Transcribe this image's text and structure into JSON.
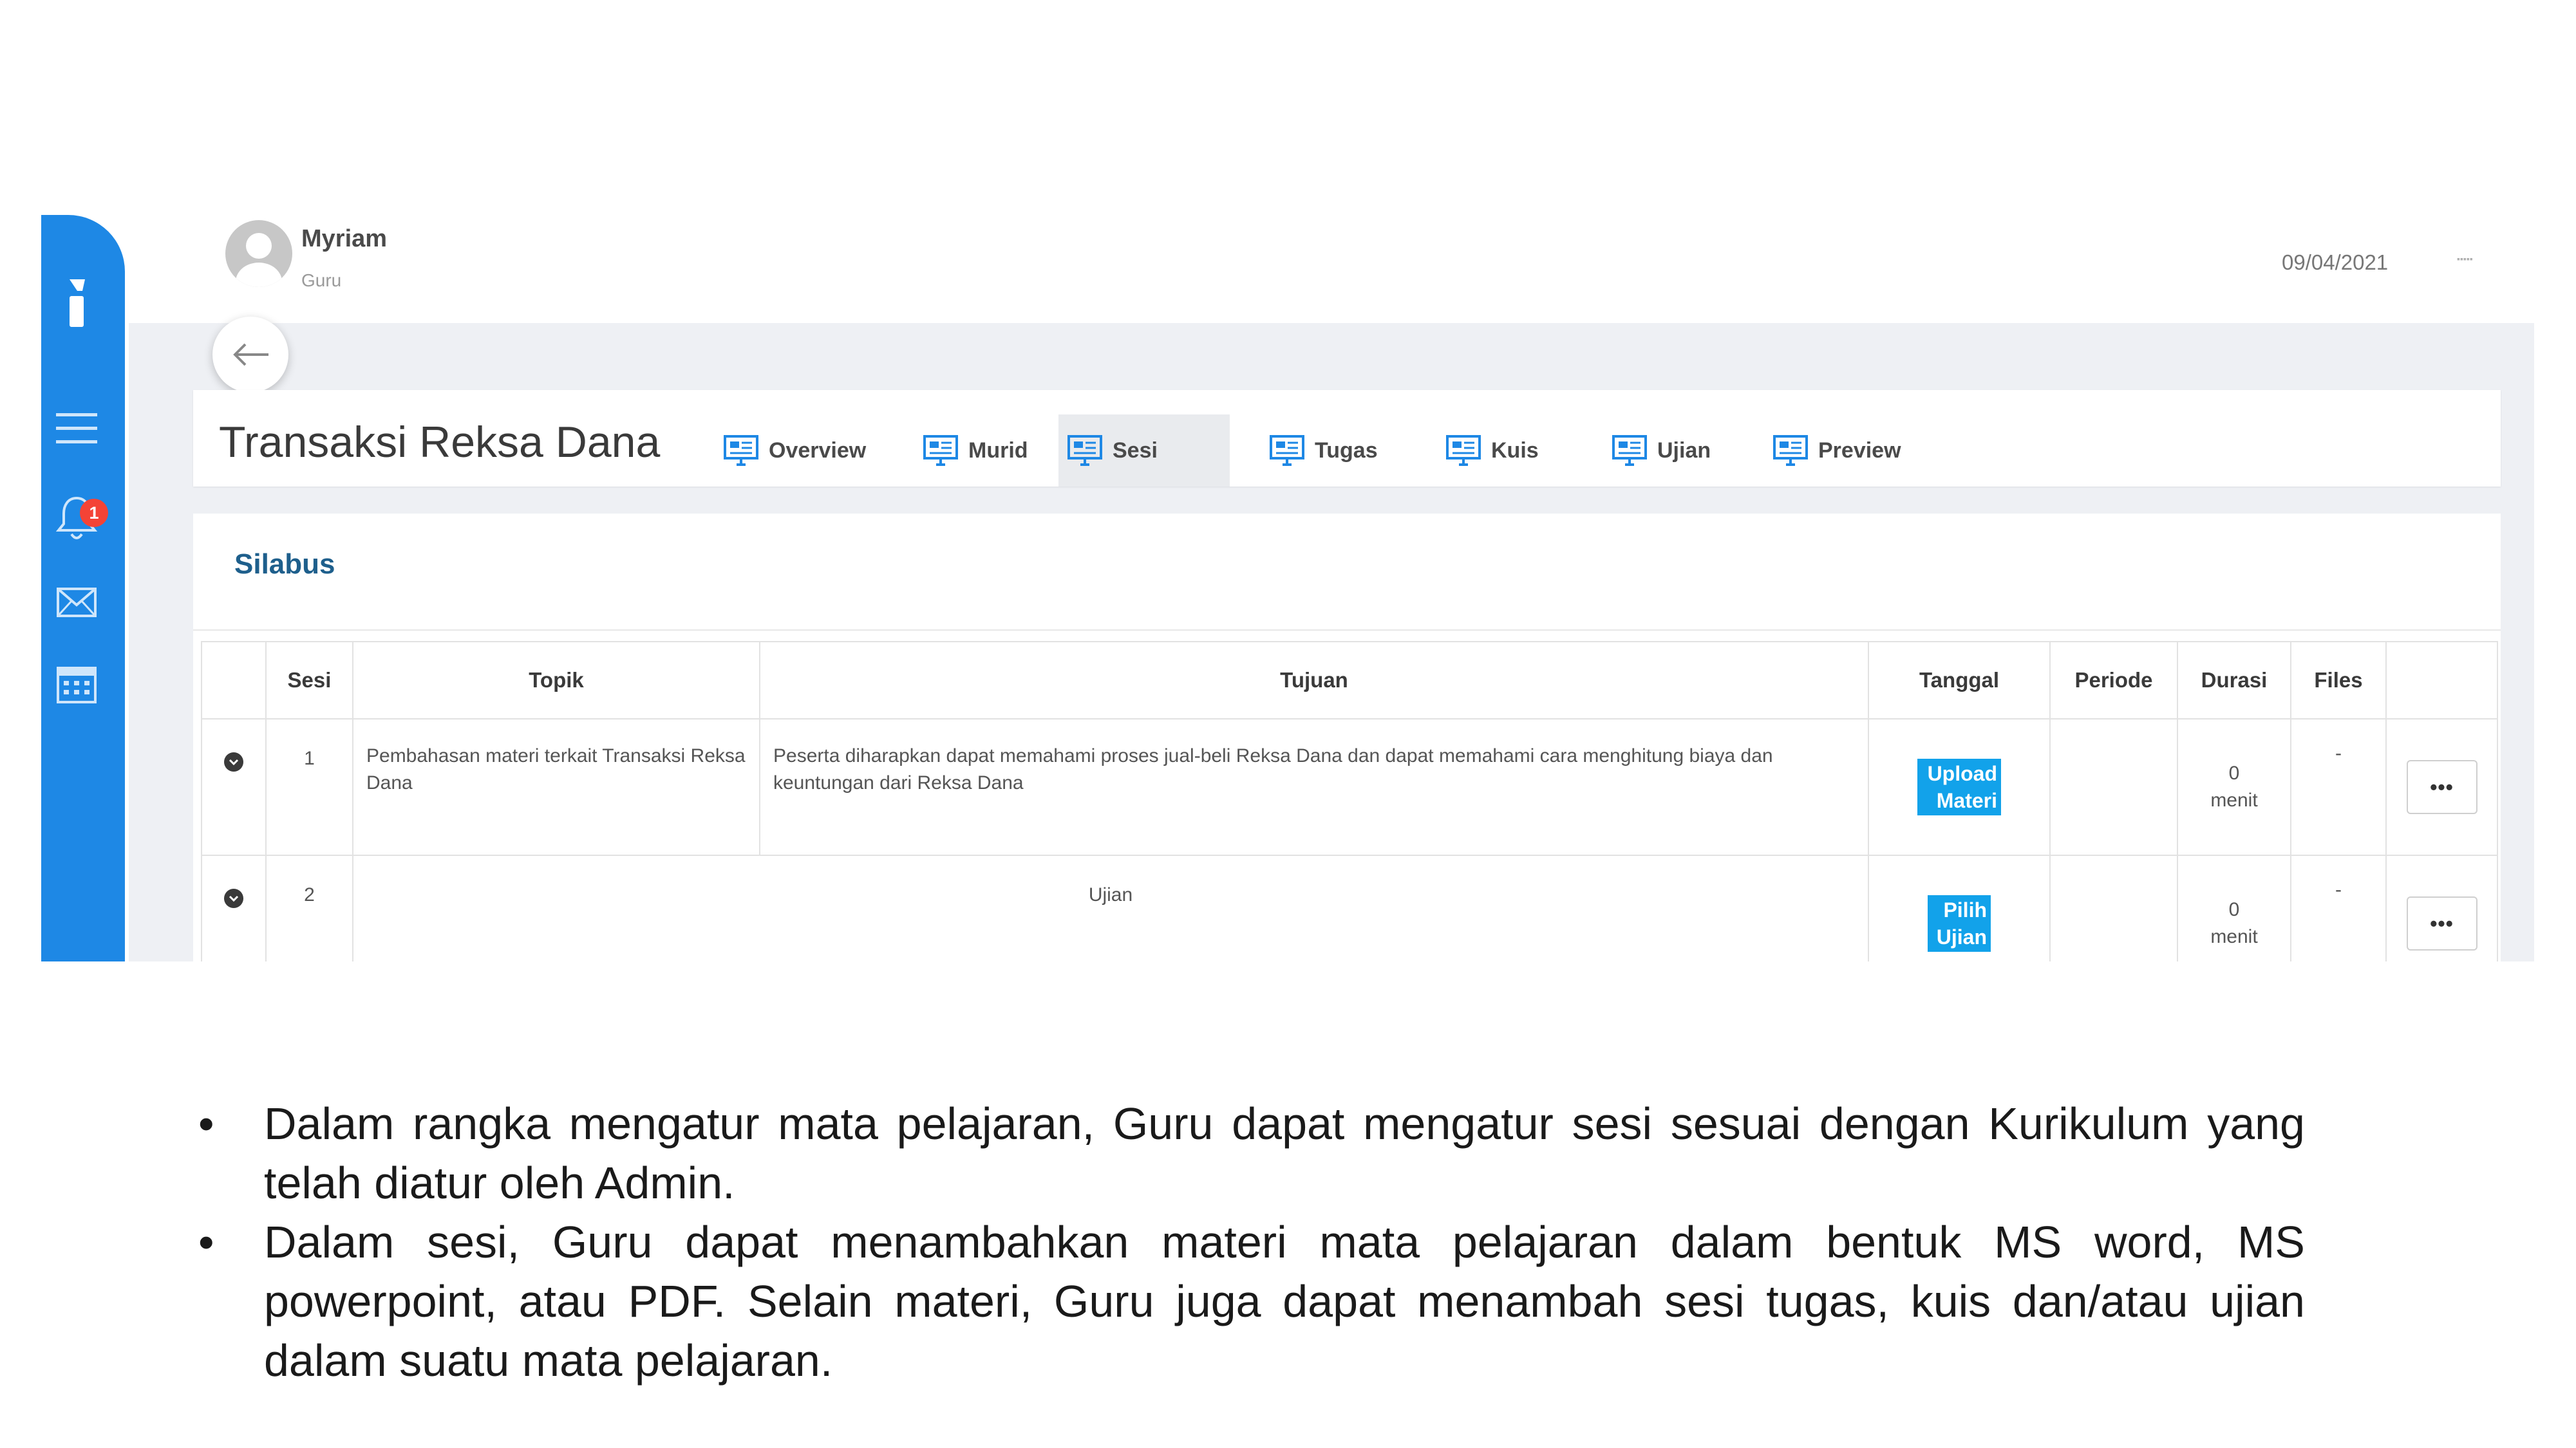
{
  "header": {
    "user_name": "Myriam",
    "user_role": "Guru",
    "date": "09/04/2021"
  },
  "course": {
    "title": "Transaksi Reksa Dana"
  },
  "tabs": [
    {
      "label": "Overview"
    },
    {
      "label": "Murid"
    },
    {
      "label": "Sesi",
      "active": true
    },
    {
      "label": "Tugas"
    },
    {
      "label": "Kuis"
    },
    {
      "label": "Ujian"
    },
    {
      "label": "Preview"
    }
  ],
  "sidebar": {
    "notification_count": "1",
    "icons": [
      "menu-icon",
      "bell-icon",
      "mail-icon",
      "calendar-icon"
    ]
  },
  "syllabus": {
    "title": "Silabus",
    "columns": [
      "Sesi",
      "Topik",
      "Tujuan",
      "Tanggal",
      "Periode",
      "Durasi",
      "Files"
    ],
    "rows": [
      {
        "sesi": "1",
        "topik": "Pembahasan materi terkait Transaksi Reksa Dana",
        "tujuan": "Peserta diharapkan dapat memahami proses jual-beli Reksa Dana dan dapat memahami cara menghitung biaya dan keuntungan dari Reksa Dana",
        "tanggal_button": "Upload Materi",
        "periode": "",
        "durasi_value": "0",
        "durasi_unit": "menit",
        "files": "-",
        "more": "•••"
      },
      {
        "sesi": "2",
        "topik": "Ujian",
        "tanggal_button": "Pilih Ujian",
        "periode": "",
        "durasi_value": "0",
        "durasi_unit": "menit",
        "files": "-",
        "more": "•••"
      }
    ]
  },
  "notes": {
    "bullet_symbol": "•",
    "items": [
      "Dalam rangka mengatur mata pelajaran, Guru dapat mengatur sesi sesuai dengan Kurikulum yang telah diatur oleh Admin.",
      "Dalam sesi, Guru dapat menambahkan materi mata pelajaran dalam bentuk MS word, MS powerpoint, atau PDF. Selain materi, Guru juga dapat menambah sesi tugas, kuis dan/atau ujian dalam suatu mata pelajaran."
    ]
  },
  "colors": {
    "sidebar": "#1e88e5",
    "accent_button": "#12a2ea",
    "badge": "#f44336",
    "panel_title": "#1e5f8c"
  }
}
